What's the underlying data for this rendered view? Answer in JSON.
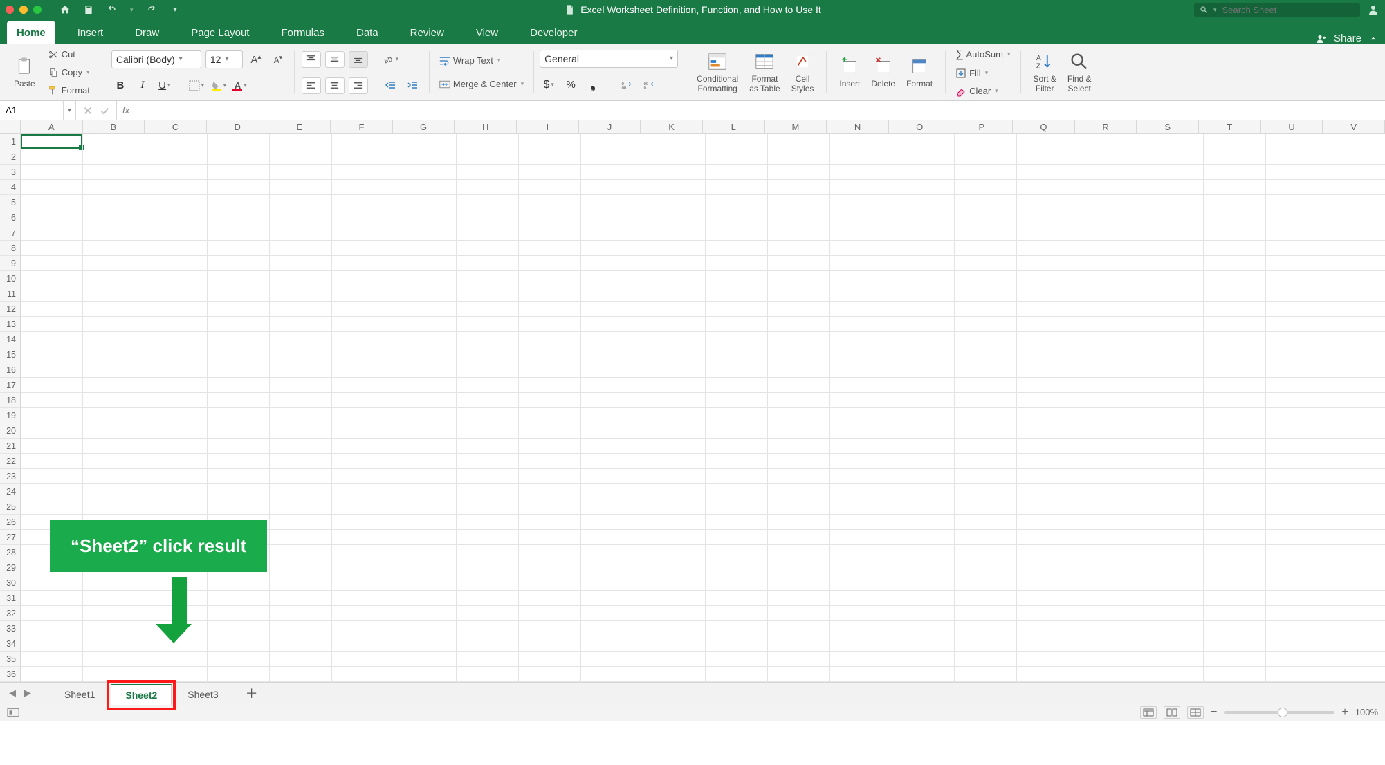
{
  "title": "Excel Worksheet Definition, Function, and How to Use It",
  "search_placeholder": "Search Sheet",
  "tabs": [
    "Home",
    "Insert",
    "Draw",
    "Page Layout",
    "Formulas",
    "Data",
    "Review",
    "View",
    "Developer"
  ],
  "share_label": "Share",
  "clipboard": {
    "paste": "Paste",
    "cut": "Cut",
    "copy": "Copy",
    "format": "Format"
  },
  "font": {
    "name": "Calibri (Body)",
    "size": "12"
  },
  "wraptext": "Wrap Text",
  "merge": "Merge & Center",
  "number_format": "General",
  "groups": {
    "cond_format": {
      "l1": "Conditional",
      "l2": "Formatting"
    },
    "as_table": {
      "l1": "Format",
      "l2": "as Table"
    },
    "cell_styles": {
      "l1": "Cell",
      "l2": "Styles"
    },
    "insert": "Insert",
    "delete": "Delete",
    "format": "Format",
    "autosum": "AutoSum",
    "fill": "Fill",
    "clear": "Clear",
    "sort": {
      "l1": "Sort &",
      "l2": "Filter"
    },
    "find": {
      "l1": "Find &",
      "l2": "Select"
    }
  },
  "namebox": "A1",
  "fx": "fx",
  "columns": [
    "A",
    "B",
    "C",
    "D",
    "E",
    "F",
    "G",
    "H",
    "I",
    "J",
    "K",
    "L",
    "M",
    "N",
    "O",
    "P",
    "Q",
    "R",
    "S",
    "T",
    "U",
    "V"
  ],
  "rowcount": 36,
  "sheets": [
    "Sheet1",
    "Sheet2",
    "Sheet3"
  ],
  "active_sheet_index": 1,
  "annotation": "“Sheet2” click result",
  "zoom": "100%"
}
